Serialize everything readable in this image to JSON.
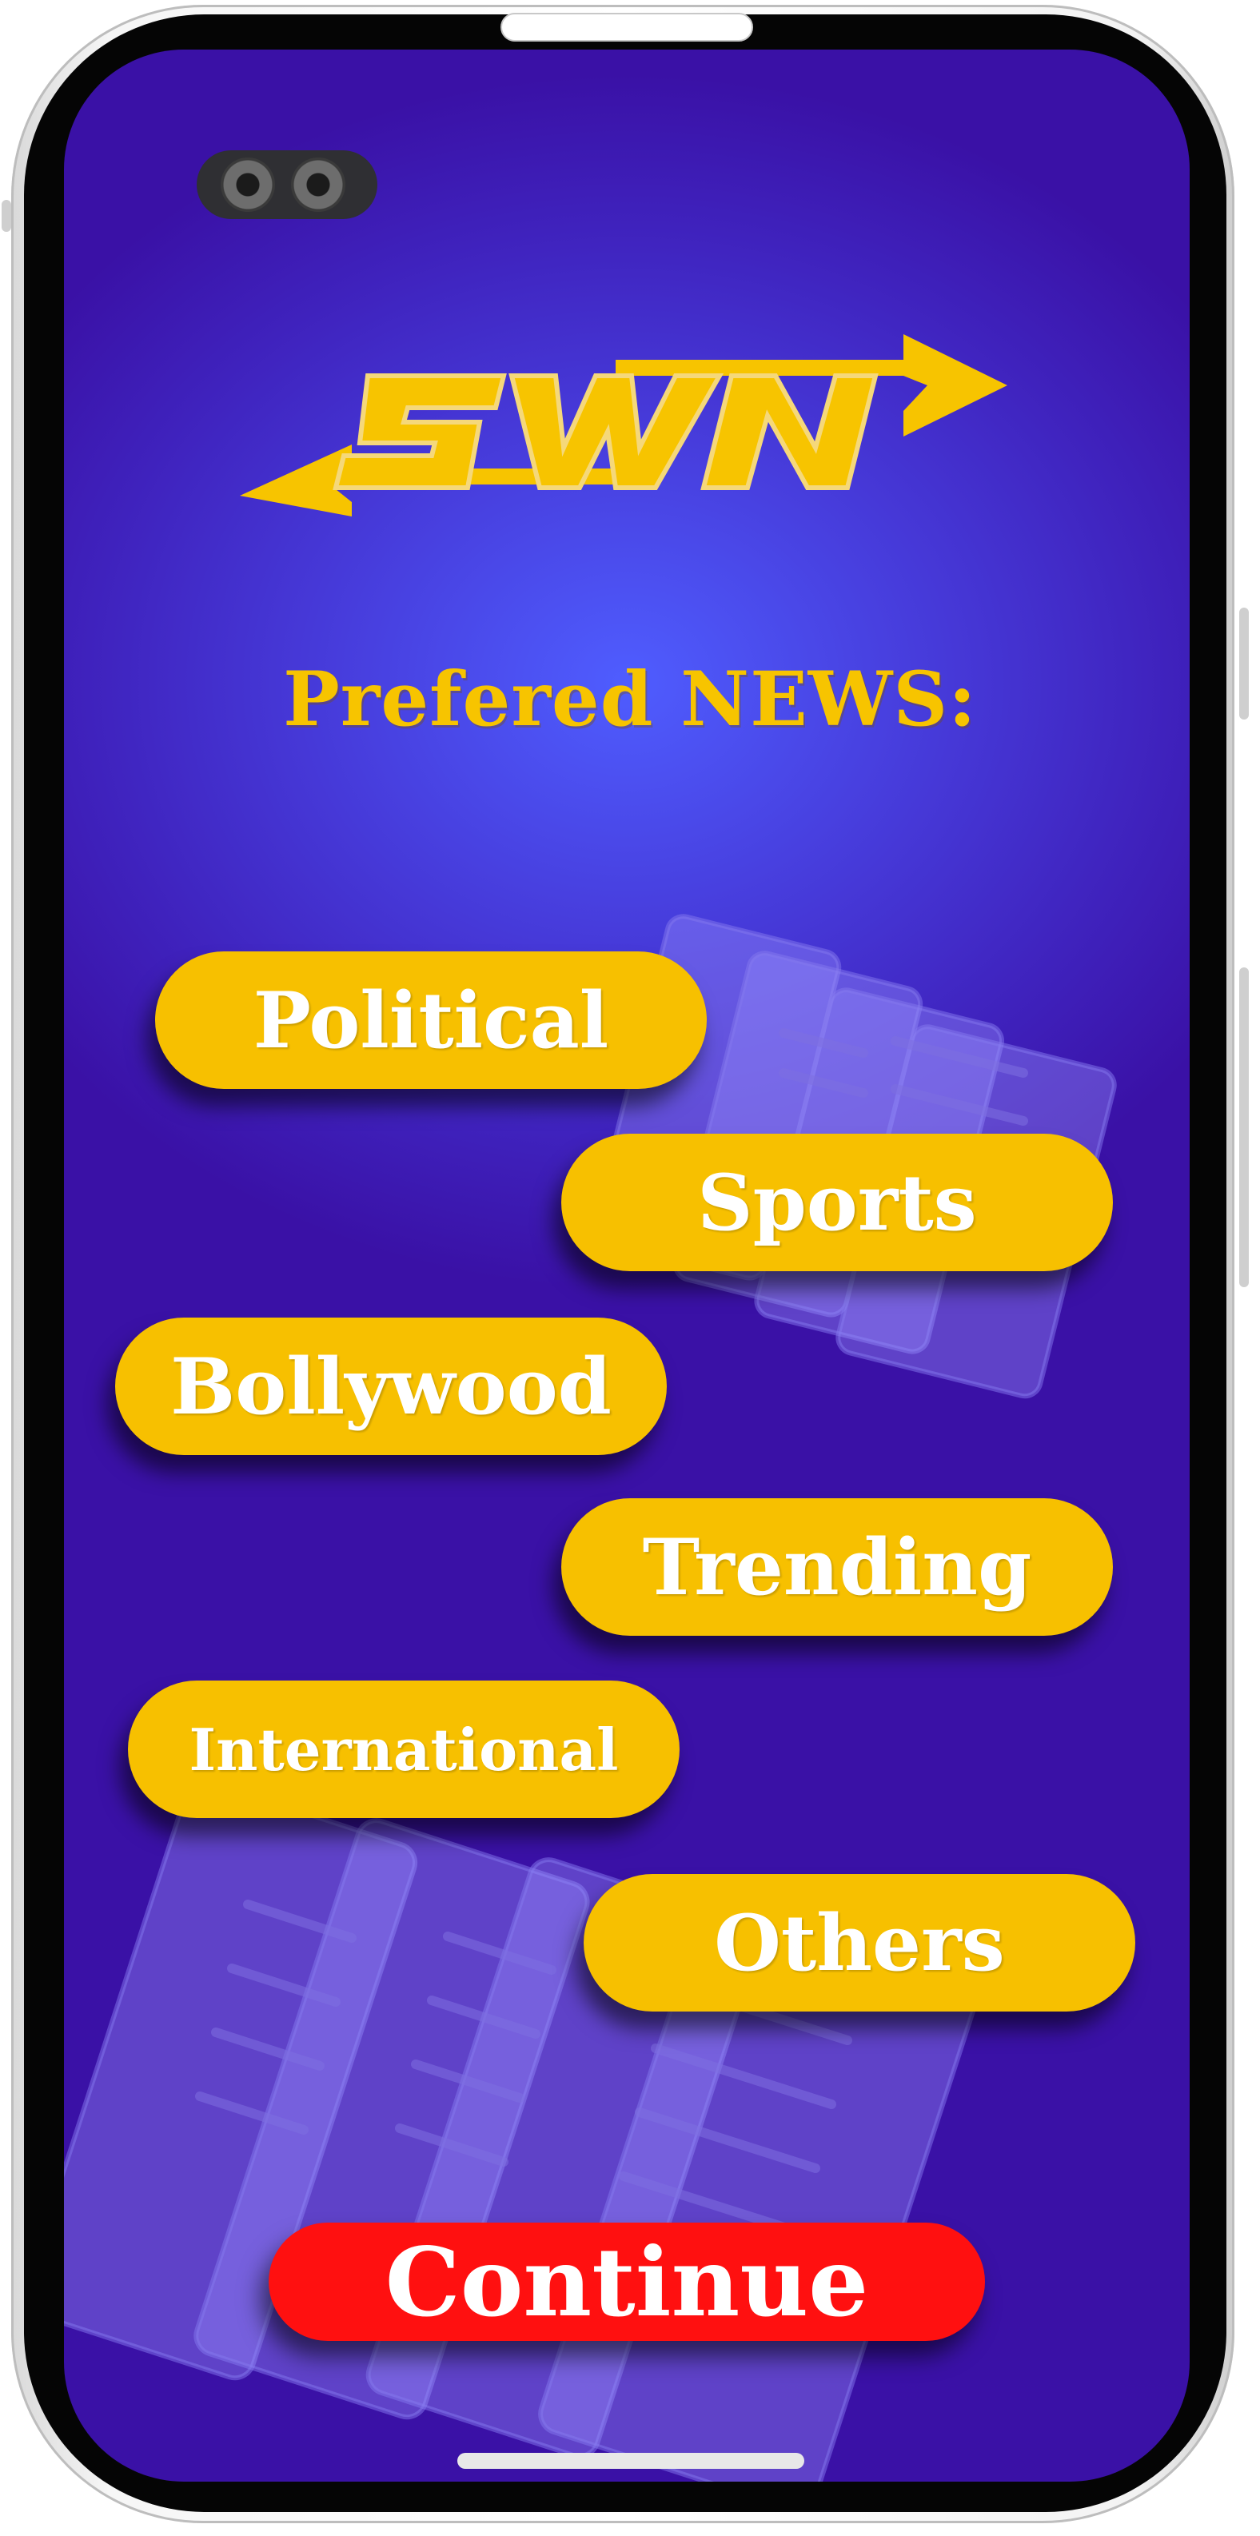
{
  "logo": {
    "text": "SWN",
    "color": "#f7c400"
  },
  "heading": "Prefered NEWS:",
  "categories": [
    {
      "label": "Political"
    },
    {
      "label": "Sports"
    },
    {
      "label": "Bollywood"
    },
    {
      "label": "Trending"
    },
    {
      "label": "International"
    },
    {
      "label": "Others"
    }
  ],
  "continue_label": "Continue",
  "colors": {
    "accent": "#f7c000",
    "button_primary": "#ff1010",
    "background_top": "#4f5dff",
    "background_bottom": "#3a11a6"
  },
  "icons": [
    "camera-lens-icon",
    "newspaper-icon",
    "swn-logo-icon"
  ]
}
